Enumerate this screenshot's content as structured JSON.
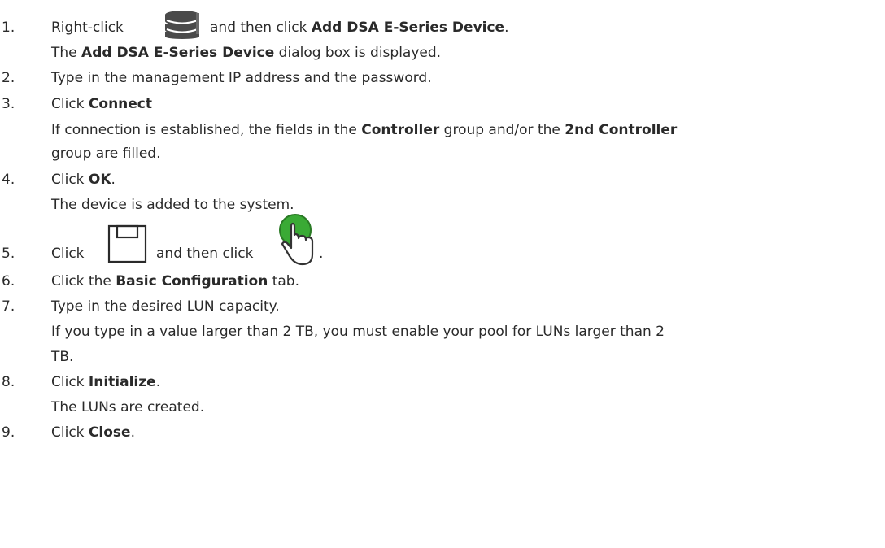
{
  "steps": [
    {
      "number": "1.",
      "text_a": "Right-click",
      "icon": "storage-database-icon",
      "text_b": "and then click",
      "bold_a": "Add DSA E-Series Device",
      "text_c": ".",
      "result_a": "The",
      "result_bold": "Add DSA E-Series Device",
      "result_b": "dialog box is displayed."
    },
    {
      "number": "2.",
      "text": "Type in the management IP address and the password."
    },
    {
      "number": "3.",
      "text_a": "Click",
      "bold_a": "Connect",
      "result_a": "If connection is established, the fields in the",
      "result_bold_a": "Controller",
      "result_b": "group and/or the",
      "result_bold_b": "2nd Controller",
      "result_c": "group are filled."
    },
    {
      "number": "4.",
      "text_a": "Click",
      "bold_a": "OK",
      "text_b": ".",
      "result": "The device is added to the system."
    },
    {
      "number": "5.",
      "text_a": "Click",
      "icon_a": "save-icon",
      "text_b": "and then click",
      "icon_b": "activate-hand-icon",
      "text_c": "."
    },
    {
      "number": "6.",
      "text_a": "Click the",
      "bold_a": "Basic Configuration",
      "text_b": "tab."
    },
    {
      "number": "7.",
      "text": "Type in the desired LUN capacity.",
      "result_a": "If you type in a value larger than 2 TB, you must enable your pool for LUNs larger than 2",
      "result_b": "TB."
    },
    {
      "number": "8.",
      "text_a": "Click",
      "bold_a": "Initialize",
      "text_b": ".",
      "result": "The LUNs are created."
    },
    {
      "number": "9.",
      "text_a": "Click",
      "bold_a": "Close",
      "text_b": "."
    }
  ],
  "colors": {
    "text": "#2a2a2a",
    "db_icon": "#4a4a4a",
    "hand_fill": "#3aaa35",
    "hand_outline": "#333333"
  }
}
